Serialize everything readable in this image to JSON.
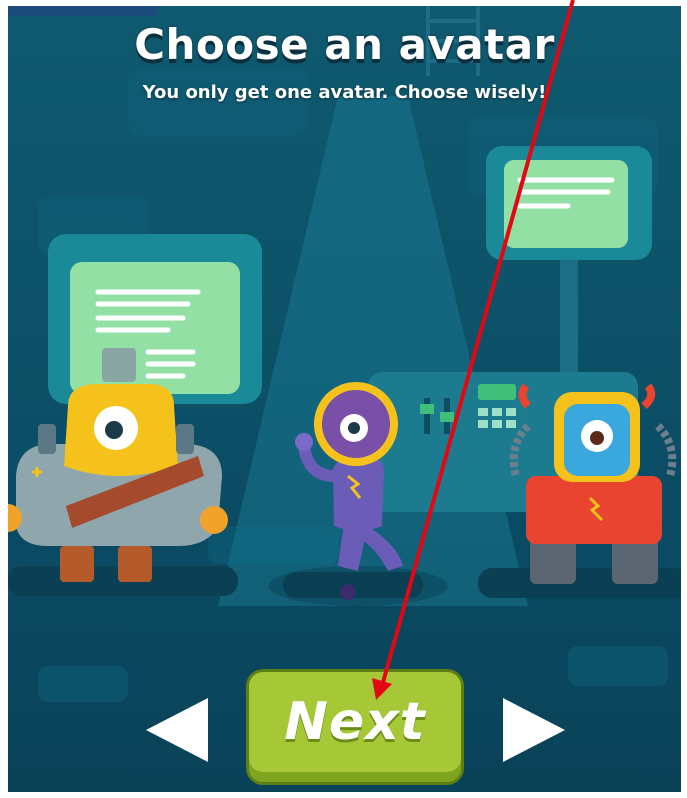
{
  "screen": {
    "title": "Choose an avatar",
    "subtitle": "You only get one avatar. Choose wisely!"
  },
  "navigation": {
    "previous_icon": "left-triangle-arrow-icon",
    "next_arrow_icon": "right-triangle-arrow-icon",
    "next_label": "Next"
  },
  "avatars": [
    {
      "name": "yellow-monster-avatar",
      "color": "#f6c21d"
    },
    {
      "name": "purple-astronaut-avatar",
      "color": "#6b5cb8"
    },
    {
      "name": "blue-robot-avatar",
      "color": "#e8442f"
    }
  ],
  "annotation": {
    "arrow_color": "#e30613",
    "description": "red pointer arrow"
  },
  "colors": {
    "background": "#0d5369",
    "button_green": "#a6c736",
    "panel_green": "#8fdc9c"
  }
}
